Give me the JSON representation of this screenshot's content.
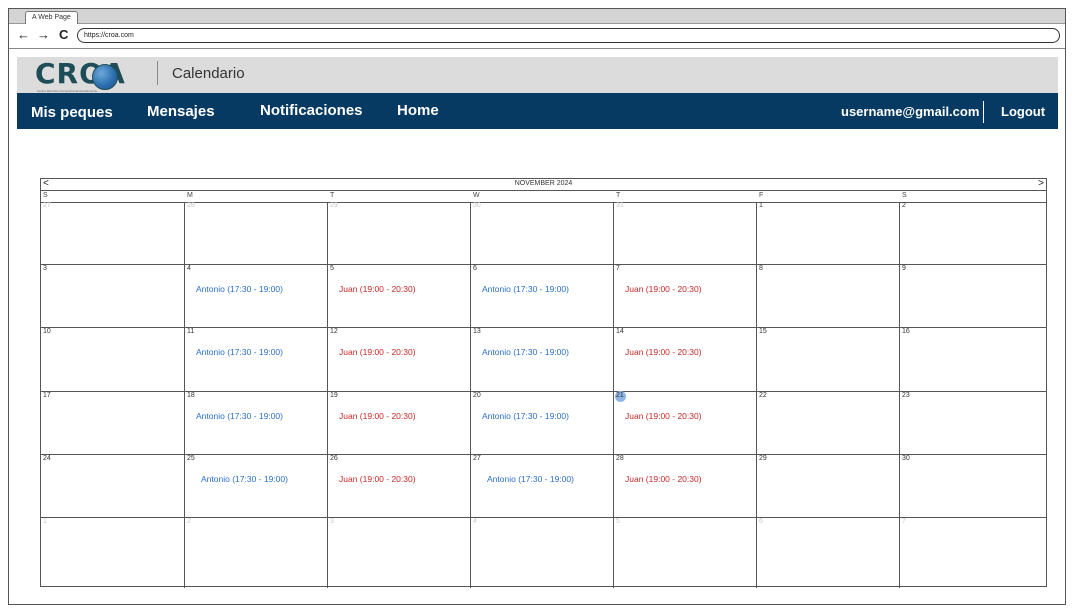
{
  "browser": {
    "tab_title": "A Web Page",
    "back_icon": "←",
    "forward_icon": "→",
    "reload_icon": "C",
    "url": "https://croa.com"
  },
  "header": {
    "logo_text": "CROA",
    "logo_subtitle": "Centro Ricerche Occupazionali Accademiche",
    "title": "Calendario"
  },
  "nav": {
    "items": [
      "Mis peques",
      "Mensajes",
      "Notificaciones",
      "Home"
    ],
    "user": "username@gmail.com",
    "logout": "Logout"
  },
  "calendar": {
    "title": "NOVEMBER 2024",
    "prev": "<",
    "next": ">",
    "weekdays": [
      "S",
      "M",
      "T",
      "W",
      "T",
      "F",
      "S"
    ],
    "weeks": [
      [
        "27",
        "28",
        "29",
        "30",
        "31",
        "1",
        "2"
      ],
      [
        "3",
        "4",
        "5",
        "6",
        "7",
        "8",
        "9"
      ],
      [
        "10",
        "11",
        "12",
        "13",
        "14",
        "15",
        "16"
      ],
      [
        "17",
        "18",
        "19",
        "20",
        "21",
        "22",
        "23"
      ],
      [
        "24",
        "25",
        "26",
        "27",
        "28",
        "29",
        "30"
      ],
      [
        "1",
        "2",
        "3",
        "4",
        "5",
        "6",
        "7"
      ]
    ],
    "muted_days": {
      "0": [
        0,
        1,
        2,
        3,
        4
      ],
      "5": [
        0,
        1,
        2,
        3,
        4,
        5,
        6
      ]
    },
    "today": {
      "week": 3,
      "day": 4
    },
    "events": [
      {
        "week": 1,
        "day": 1,
        "text": "Antonio (17:30 - 19:00)",
        "color": "#2a6fc9"
      },
      {
        "week": 1,
        "day": 2,
        "text": "Juan (19:00 - 20:30)",
        "color": "#c62828"
      },
      {
        "week": 1,
        "day": 3,
        "text": "Antonio (17:30 - 19:00)",
        "color": "#2a6fc9"
      },
      {
        "week": 1,
        "day": 4,
        "text": "Juan (19:00 - 20:30)",
        "color": "#c62828"
      },
      {
        "week": 2,
        "day": 1,
        "text": "Antonio (17:30 - 19:00)",
        "color": "#2a6fc9"
      },
      {
        "week": 2,
        "day": 2,
        "text": "Juan (19:00 - 20:30)",
        "color": "#c62828"
      },
      {
        "week": 2,
        "day": 3,
        "text": "Antonio (17:30 - 19:00)",
        "color": "#2a6fc9"
      },
      {
        "week": 2,
        "day": 4,
        "text": "Juan (19:00 - 20:30)",
        "color": "#c62828"
      },
      {
        "week": 3,
        "day": 1,
        "text": "Antonio (17:30 - 19:00)",
        "color": "#2a6fc9"
      },
      {
        "week": 3,
        "day": 2,
        "text": "Juan (19:00 - 20:30)",
        "color": "#c62828"
      },
      {
        "week": 3,
        "day": 3,
        "text": "Antonio (17:30 - 19:00)",
        "color": "#2a6fc9"
      },
      {
        "week": 3,
        "day": 4,
        "text": "Juan (19:00 - 20:30)",
        "color": "#c62828"
      },
      {
        "week": 4,
        "day": 1,
        "text": "Antonio (17:30 - 19:00)",
        "color": "#2a6fc9"
      },
      {
        "week": 4,
        "day": 2,
        "text": "Juan (19:00 - 20:30)",
        "color": "#c62828"
      },
      {
        "week": 4,
        "day": 3,
        "text": "Antonio (17:30 - 19:00)",
        "color": "#2a6fc9"
      },
      {
        "week": 4,
        "day": 4,
        "text": "Juan (19:00 - 20:30)",
        "color": "#c62828"
      }
    ]
  },
  "colors": {
    "nav_bg": "#073a63",
    "header_bg": "#dcdcdc",
    "antonio": "#2a6fc9",
    "juan": "#c62828",
    "today": "#8fb4e6"
  }
}
